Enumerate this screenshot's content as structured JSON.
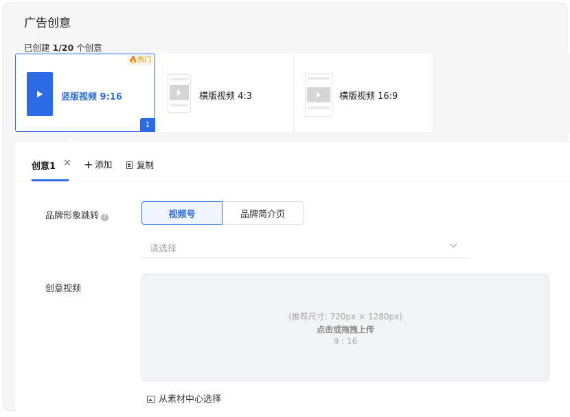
{
  "header": {
    "title": "广告创意",
    "count_prefix": "已创建",
    "count_value": "1/20",
    "count_suffix": "个创意"
  },
  "formats": [
    {
      "label": "竖版视频 9:16",
      "badge": "热门",
      "index": "1",
      "selected": true
    },
    {
      "label": "横版视频 4:3",
      "selected": false
    },
    {
      "label": "横版视频 16:9",
      "selected": false
    }
  ],
  "tabs": {
    "active_label": "创意1",
    "close_glyph": "×",
    "add_label": "添加",
    "copy_label": "复制"
  },
  "brand": {
    "label": "品牌形象跳转",
    "help_glyph": "?",
    "options": [
      "视频号",
      "品牌简介页"
    ],
    "selected": "视频号",
    "select_placeholder": "请选择"
  },
  "video": {
    "label": "创意视频",
    "size_hint": "(推荐尺寸: 720px × 1280px)",
    "upload_text": "点击或拖拽上传",
    "ratio": "9 : 16",
    "library_link": "从素材中心选择"
  },
  "colors": {
    "accent": "#2b6be6",
    "hot": "#f08a00"
  }
}
